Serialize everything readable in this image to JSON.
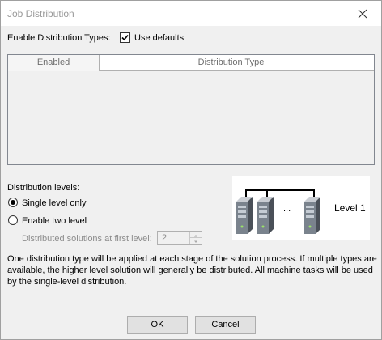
{
  "window": {
    "title": "Job Distribution"
  },
  "enable_types": {
    "label": "Enable Distribution Types:",
    "use_defaults_label": "Use defaults",
    "use_defaults_checked": true
  },
  "table": {
    "columns": [
      "Enabled",
      "Distribution Type"
    ],
    "rows": []
  },
  "levels": {
    "label": "Distribution levels:",
    "options": [
      {
        "label": "Single level only",
        "selected": true
      },
      {
        "label": "Enable two level",
        "selected": false
      }
    ],
    "first_level_label": "Distributed solutions at first level:",
    "first_level_value": "2"
  },
  "diagram": {
    "ellipsis": "...",
    "level_label": "Level 1",
    "server_count": 3
  },
  "description": "One distribution type will be applied at each stage of the solution process. If multiple types are available, the higher level solution will generally be distributed. All machine tasks will be used by the single-level distribution.",
  "buttons": {
    "ok": "OK",
    "cancel": "Cancel"
  }
}
